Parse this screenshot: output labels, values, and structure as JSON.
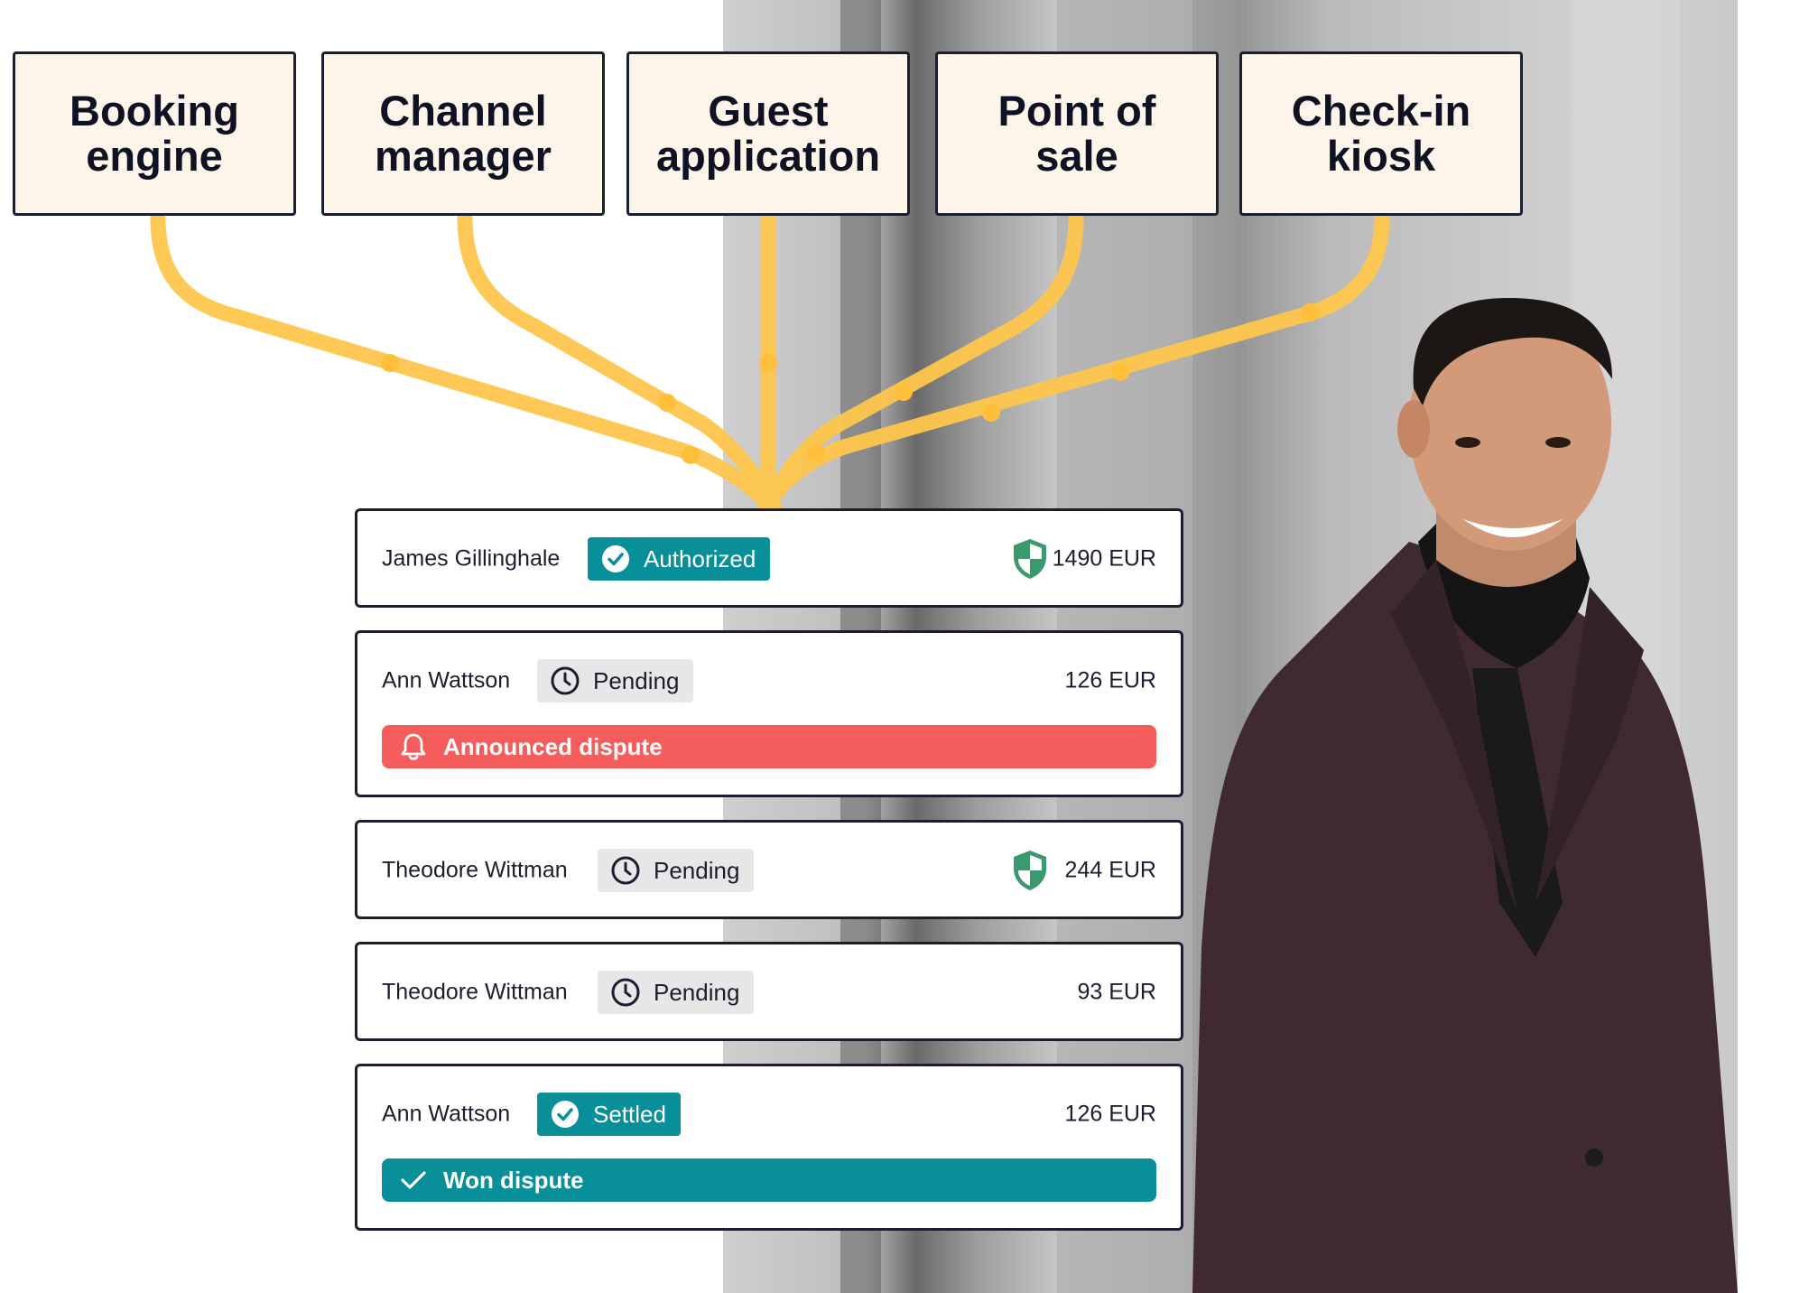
{
  "sources": [
    {
      "label": "Booking\nengine"
    },
    {
      "label": "Channel\nmanager"
    },
    {
      "label": "Guest\napplication"
    },
    {
      "label": "Point of\nsale"
    },
    {
      "label": "Check-in\nkiosk"
    }
  ],
  "payments": [
    {
      "guest": "James Gillinghale",
      "status": "Authorized",
      "status_icon": "check-circle-icon",
      "amount": "1490 EUR",
      "protected": true
    },
    {
      "guest": "Ann Wattson",
      "status": "Pending",
      "status_icon": "clock-icon",
      "amount": "126 EUR",
      "protected": false,
      "alert": {
        "text": "Announced dispute",
        "icon": "bell-icon"
      }
    },
    {
      "guest": "Theodore Wittman",
      "status": "Pending",
      "status_icon": "clock-icon",
      "amount": "244 EUR",
      "protected": true
    },
    {
      "guest": "Theodore Wittman",
      "status": "Pending",
      "status_icon": "clock-icon",
      "amount": "93 EUR",
      "protected": false
    },
    {
      "guest": "Ann Wattson",
      "status": "Settled",
      "status_icon": "check-circle-icon",
      "amount": "126 EUR",
      "protected": false,
      "alert": {
        "text": "Won dispute",
        "icon": "checkmark-icon"
      }
    }
  ],
  "colors": {
    "connector": "#ffc64d",
    "connector_dot": "#ffbf3a",
    "teal": "#088f99",
    "dispute_red": "#f55c5c",
    "shield_green": "#3a9a6e",
    "box_fill": "#fdf4ea",
    "border": "#1b1e2e"
  }
}
